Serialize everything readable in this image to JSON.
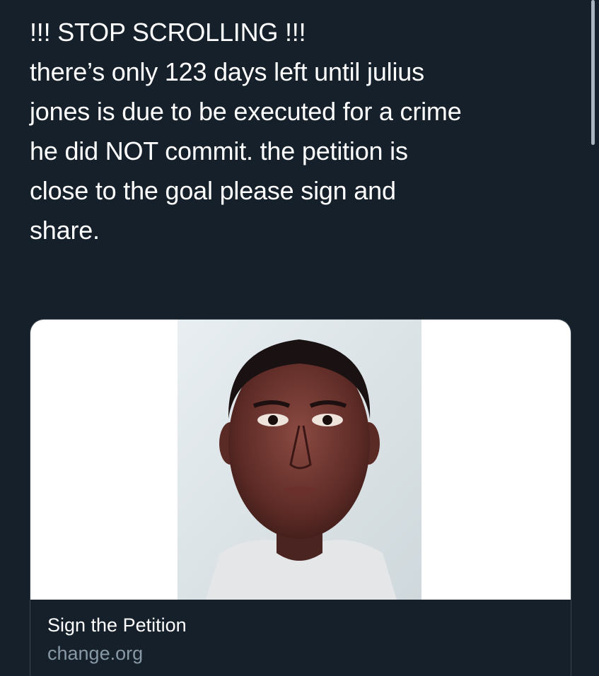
{
  "tweet": {
    "text": "!!! STOP SCROLLING !!!\nthere’s only 123 days left until julius\njones is due to be executed for a crime\nhe did NOT commit. the petition is\nclose to the goal please sign and\nshare."
  },
  "card": {
    "image_icon": "portrait-photo",
    "title": "Sign the Petition",
    "domain": "change.org"
  },
  "colors": {
    "background": "#15202b",
    "text": "#ffffff",
    "muted": "#8899a6",
    "border": "#38444d"
  }
}
